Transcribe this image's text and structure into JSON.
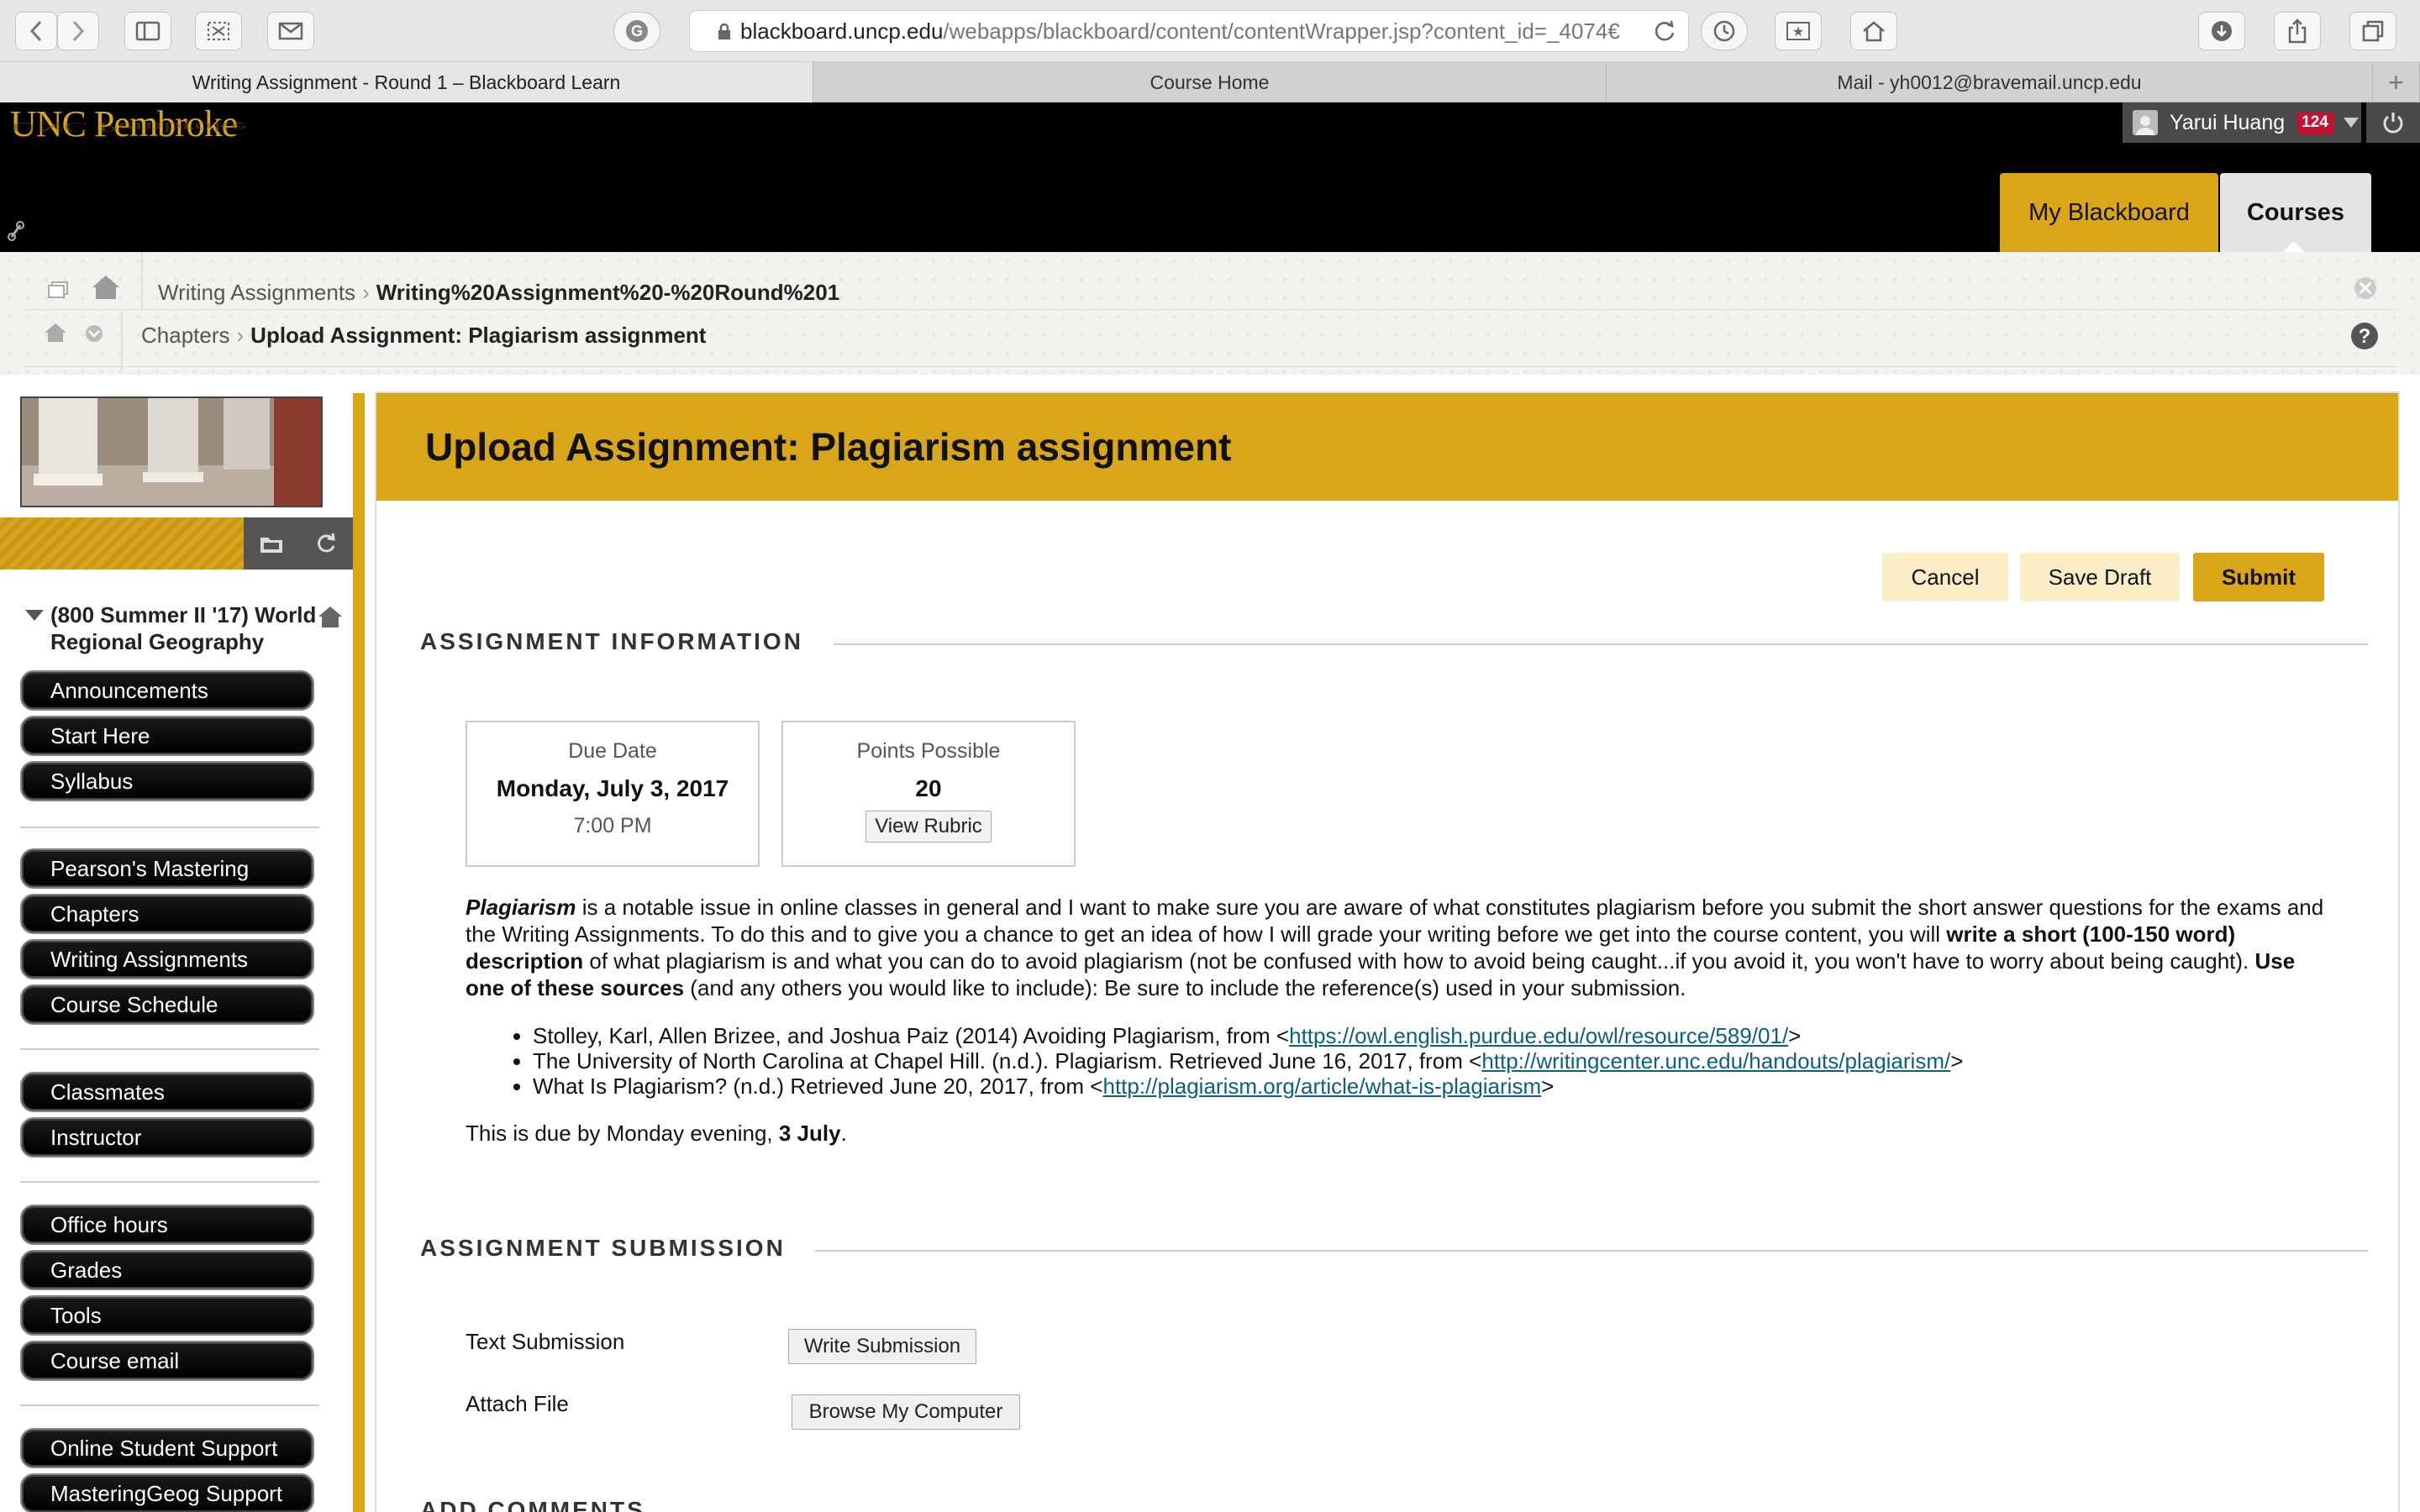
{
  "browser": {
    "url_domain": "blackboard.uncp.edu",
    "url_path": "/webapps/blackboard/content/contentWrapper.jsp?content_id=_4074€",
    "tabs": [
      {
        "label": "Writing Assignment - Round 1 – Blackboard Learn",
        "active": true
      },
      {
        "label": "Course Home",
        "active": false
      },
      {
        "label": "Mail - yh0012@bravemail.uncp.edu",
        "active": false
      }
    ]
  },
  "header": {
    "logo": "UNC Pembroke",
    "user_name": "Yarui Huang",
    "notification_count": "124",
    "nav_tabs": [
      "My Blackboard",
      "Courses"
    ]
  },
  "breadcrumbs": {
    "row1": [
      "Writing Assignments",
      "Writing%20Assignment%20-%20Round%201"
    ],
    "row2": [
      "Chapters",
      "Upload Assignment: Plagiarism assignment"
    ]
  },
  "sidebar": {
    "course_title": "(800 Summer II '17) World Regional Geography",
    "groups": [
      [
        "Announcements",
        "Start Here",
        "Syllabus"
      ],
      [
        "Pearson's Mastering",
        "Chapters",
        "Writing Assignments",
        "Course Schedule"
      ],
      [
        "Classmates",
        "Instructor"
      ],
      [
        "Office hours",
        "Grades",
        "Tools",
        "Course email"
      ],
      [
        "Online Student Support",
        "MasteringGeog Support"
      ]
    ]
  },
  "main": {
    "title": "Upload Assignment: Plagiarism assignment",
    "buttons": {
      "cancel": "Cancel",
      "save_draft": "Save Draft",
      "submit": "Submit"
    },
    "info_heading": "ASSIGNMENT INFORMATION",
    "due": {
      "label": "Due Date",
      "date": "Monday, July 3, 2017",
      "time": "7:00 PM"
    },
    "points": {
      "label": "Points Possible",
      "value": "20",
      "rubric_button": "View Rubric"
    },
    "description": {
      "p1_em": "Plagiarism",
      "p1_a": " is a notable issue in online classes in general and I want to make sure you are aware of what constitutes plagiarism before you submit the short answer questions for the exams and the Writing Assignments. To do this and to give you a chance to get an idea of how I will grade your writing before we get into the course content, you will ",
      "p1_b1": "write a short (100-150 word) description",
      "p1_c": " of what plagiarism is and what you can do to avoid plagiarism (not be confused with how to avoid being caught...if you avoid it, you won't have to worry about being caught). ",
      "p1_b2": "Use one of these sources",
      "p1_d": " (and any others you would like to include): Be sure to include the reference(s) used in your submission."
    },
    "references": [
      {
        "text": "Stolley, Karl, Allen Brizee, and Joshua Paiz (2014) Avoiding Plagiarism, from <",
        "link": "https://owl.english.purdue.edu/owl/resource/589/01/",
        "end": ">"
      },
      {
        "text": "The University of North Carolina at Chapel Hill. (n.d.). Plagiarism. Retrieved June 16, 2017, from <",
        "link": "http://writingcenter.unc.edu/handouts/plagiarism/",
        "end": ">"
      },
      {
        "text": "What Is Plagiarism? (n.d.) Retrieved June 20, 2017, from <",
        "link": "http://plagiarism.org/article/what-is-plagiarism",
        "end": ">"
      }
    ],
    "due_note_a": "This is due by Monday evening, ",
    "due_note_b": "3 July",
    "due_note_c": ".",
    "submission_heading": "ASSIGNMENT SUBMISSION",
    "text_submission_label": "Text Submission",
    "write_submission_button": "Write Submission",
    "attach_file_label": "Attach File",
    "browse_button": "Browse My Computer",
    "comments_heading": "ADD COMMENTS"
  },
  "colors": {
    "gold": "#d9a61a",
    "black": "#000000",
    "link": "#0b5f85"
  }
}
